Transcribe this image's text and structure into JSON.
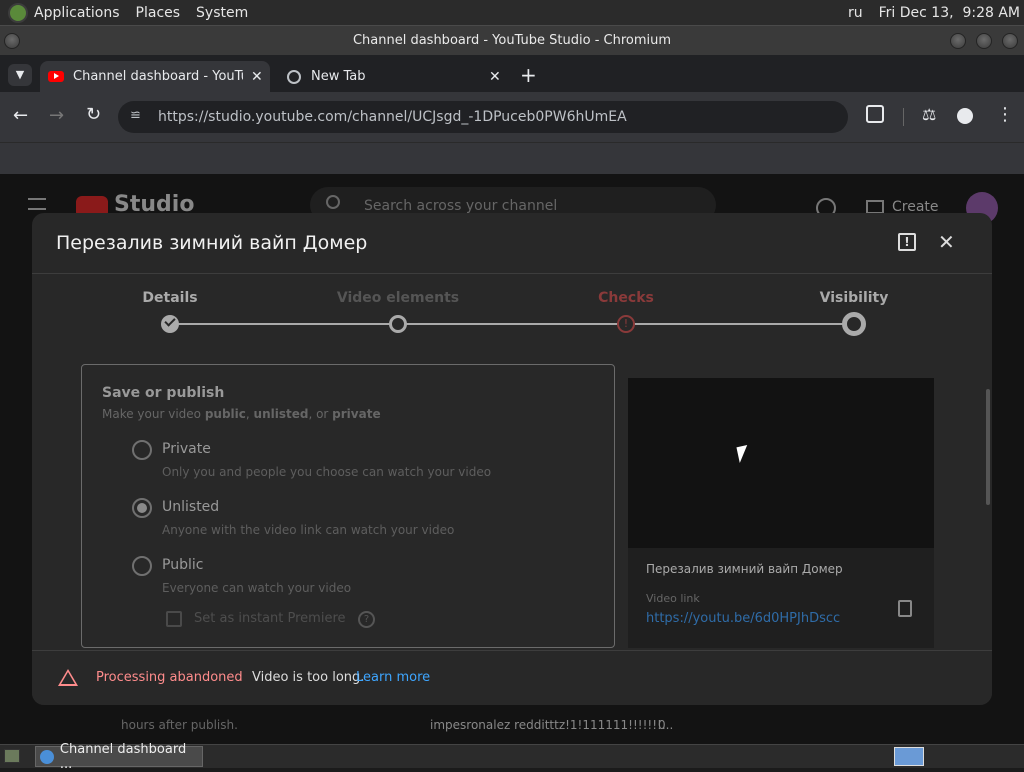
{
  "desktop": {
    "menu": [
      "Applications",
      "Places",
      "System"
    ],
    "keyboard_layout": "ru",
    "clock": "Fri Dec 13,  9:28 AM"
  },
  "window": {
    "title": "Channel dashboard - YouTube Studio - Chromium"
  },
  "tabs": [
    {
      "label": "Channel dashboard - YouTub",
      "active": true
    },
    {
      "label": "New Tab",
      "active": false
    }
  ],
  "address_bar": {
    "url": "https://studio.youtube.com/channel/UCJsgd_-1DPuceb0PW6hUmEA"
  },
  "studio": {
    "logo_text": "Studio",
    "search_placeholder": "Search across your channel",
    "create_label": "Create",
    "bg_text_1": "hours after publish.",
    "bg_text_2": "impesronalez redditttz!1!111111!!!!!!!...",
    "bg_count": "0"
  },
  "modal": {
    "title": "Перезалив зимний вайп Домер",
    "steps": [
      {
        "label": "Details",
        "state": "done"
      },
      {
        "label": "Video elements",
        "state": "disabled"
      },
      {
        "label": "Checks",
        "state": "warning"
      },
      {
        "label": "Visibility",
        "state": "current"
      }
    ],
    "save_publish": {
      "heading": "Save or publish",
      "subtitle_prefix": "Make your video ",
      "subtitle_public": "public",
      "subtitle_sep1": ", ",
      "subtitle_unlisted": "unlisted",
      "subtitle_sep2": ", or ",
      "subtitle_private": "private",
      "options": [
        {
          "label": "Private",
          "description": "Only you and people you choose can watch your video",
          "selected": false
        },
        {
          "label": "Unlisted",
          "description": "Anyone with the video link can watch your video",
          "selected": true
        },
        {
          "label": "Public",
          "description": "Everyone can watch your video",
          "selected": false
        }
      ],
      "premiere_label": "Set as instant Premiere"
    },
    "preview": {
      "video_title": "Перезалив зимний вайп Домер",
      "link_label": "Video link",
      "link": "https://youtu.be/6d0HPJhDscc"
    },
    "footer": {
      "status": "Processing abandoned",
      "message": "Video is too long.",
      "learn_more": "Learn more"
    }
  },
  "taskbar": {
    "item": "Channel dashboard ..."
  },
  "colors": {
    "warning": "#ff8c8c",
    "link": "#3ea6ff",
    "accent_red": "#ff0000"
  }
}
